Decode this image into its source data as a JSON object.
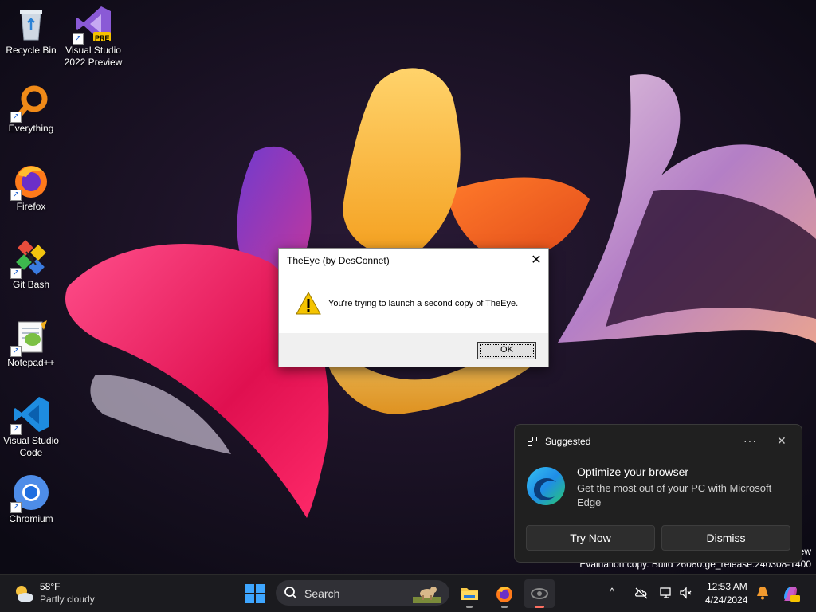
{
  "desktop": {
    "icons": [
      {
        "label": "Recycle Bin",
        "icon": "recycle-bin-icon"
      },
      {
        "label": "Visual Studio 2022 Preview",
        "icon": "visual-studio-preview-icon",
        "badge": "PRE"
      },
      {
        "label": "Everything",
        "icon": "everything-search-icon"
      },
      {
        "label": "Firefox",
        "icon": "firefox-icon"
      },
      {
        "label": "Git Bash",
        "icon": "git-bash-icon"
      },
      {
        "label": "Notepad++",
        "icon": "notepad-plus-plus-icon"
      },
      {
        "label": "Visual Studio Code",
        "icon": "vscode-icon"
      },
      {
        "label": "Chromium",
        "icon": "chromium-icon"
      }
    ],
    "watermark_line1": "ew",
    "watermark_line2": "Evaluation copy. Build 26080.ge_release.240308-1400"
  },
  "dialog": {
    "title": "TheEye (by DesConnet)",
    "close_glyph": "✕",
    "message": "You're trying to launch a second copy of TheEye.",
    "ok_label": "OK",
    "icon": "warning-icon"
  },
  "notification": {
    "header": "Suggested",
    "more_glyph": "···",
    "close_glyph": "✕",
    "title": "Optimize your browser",
    "text": "Get the most out of your PC with Microsoft Edge",
    "try_now_label": "Try Now",
    "dismiss_label": "Dismiss",
    "icon": "edge-icon"
  },
  "taskbar": {
    "weather_temp": "58°F",
    "weather_condition": "Partly cloudy",
    "search_label": "Search",
    "apps": [
      "file-explorer-icon",
      "firefox-icon",
      "theeye-icon"
    ],
    "tray_chevron": "^",
    "clock_time": "12:53 AM",
    "clock_date": "4/24/2024"
  },
  "colors": {
    "accent": "#0078d4",
    "toast_bg": "#202020",
    "taskbar_bg": "#1b1b1f"
  }
}
